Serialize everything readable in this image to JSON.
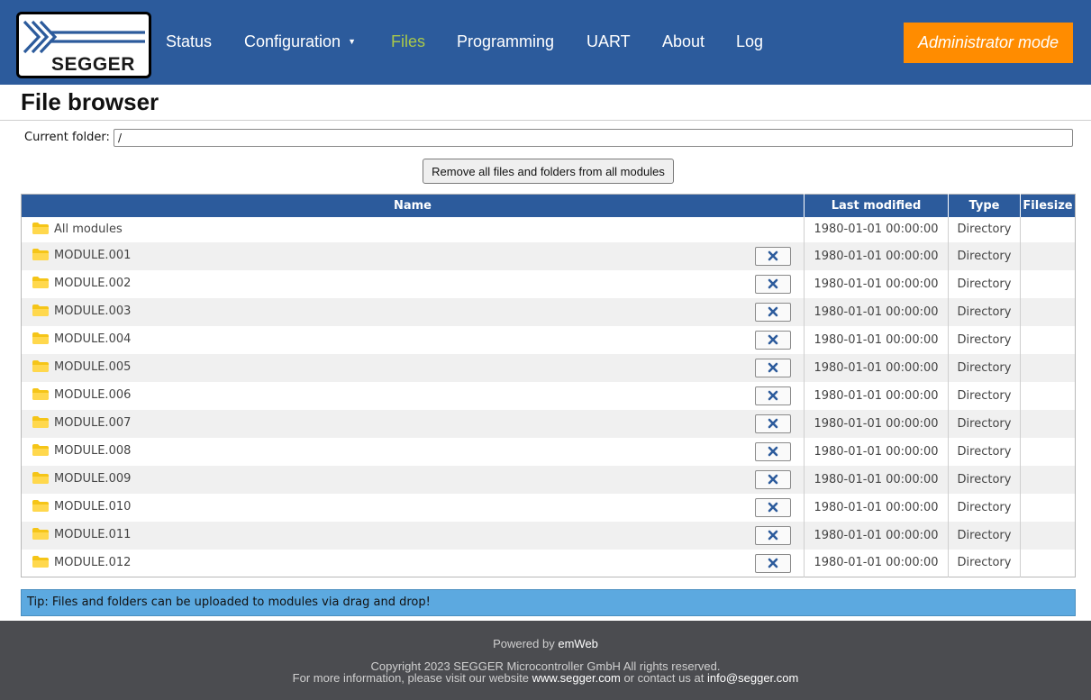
{
  "header": {
    "logo_text": "SEGGER",
    "nav": [
      {
        "label": "Status"
      },
      {
        "label": "Configuration"
      },
      {
        "label": "Files"
      },
      {
        "label": "Programming"
      },
      {
        "label": "UART"
      },
      {
        "label": "About"
      },
      {
        "label": "Log"
      }
    ],
    "admin_button": "Administrator mode",
    "colors": {
      "bar": "#2c5b9c",
      "active_nav": "#a8c84a",
      "admin": "#ff8c00"
    }
  },
  "page": {
    "title": "File browser",
    "current_folder_label": "Current folder:",
    "current_folder_value": "/",
    "remove_all_button": "Remove all files and folders from all modules"
  },
  "table": {
    "headers": [
      "Name",
      "Last modified",
      "Type",
      "Filesize"
    ],
    "rows": [
      {
        "name": "All modules",
        "modified": "1980-01-01 00:00:00",
        "type": "Directory",
        "size": ""
      },
      {
        "name": "MODULE.001",
        "modified": "1980-01-01 00:00:00",
        "type": "Directory",
        "size": ""
      },
      {
        "name": "MODULE.002",
        "modified": "1980-01-01 00:00:00",
        "type": "Directory",
        "size": ""
      },
      {
        "name": "MODULE.003",
        "modified": "1980-01-01 00:00:00",
        "type": "Directory",
        "size": ""
      },
      {
        "name": "MODULE.004",
        "modified": "1980-01-01 00:00:00",
        "type": "Directory",
        "size": ""
      },
      {
        "name": "MODULE.005",
        "modified": "1980-01-01 00:00:00",
        "type": "Directory",
        "size": ""
      },
      {
        "name": "MODULE.006",
        "modified": "1980-01-01 00:00:00",
        "type": "Directory",
        "size": ""
      },
      {
        "name": "MODULE.007",
        "modified": "1980-01-01 00:00:00",
        "type": "Directory",
        "size": ""
      },
      {
        "name": "MODULE.008",
        "modified": "1980-01-01 00:00:00",
        "type": "Directory",
        "size": ""
      },
      {
        "name": "MODULE.009",
        "modified": "1980-01-01 00:00:00",
        "type": "Directory",
        "size": ""
      },
      {
        "name": "MODULE.010",
        "modified": "1980-01-01 00:00:00",
        "type": "Directory",
        "size": ""
      },
      {
        "name": "MODULE.011",
        "modified": "1980-01-01 00:00:00",
        "type": "Directory",
        "size": ""
      },
      {
        "name": "MODULE.012",
        "modified": "1980-01-01 00:00:00",
        "type": "Directory",
        "size": ""
      }
    ],
    "row_icon": "folder-icon",
    "delete_icon": "close-icon"
  },
  "tip": "Tip: Files and folders can be uploaded to modules via drag and drop!",
  "footer": {
    "powered_prefix": "Powered by",
    "powered_link": "emWeb",
    "copyright": "Copyright 2023 SEGGER Microcontroller GmbH All rights reserved.",
    "info_prefix": "For more information, please visit our website",
    "website": "www.segger.com",
    "info_mid": "or contact us at",
    "email": "info@segger.com"
  }
}
